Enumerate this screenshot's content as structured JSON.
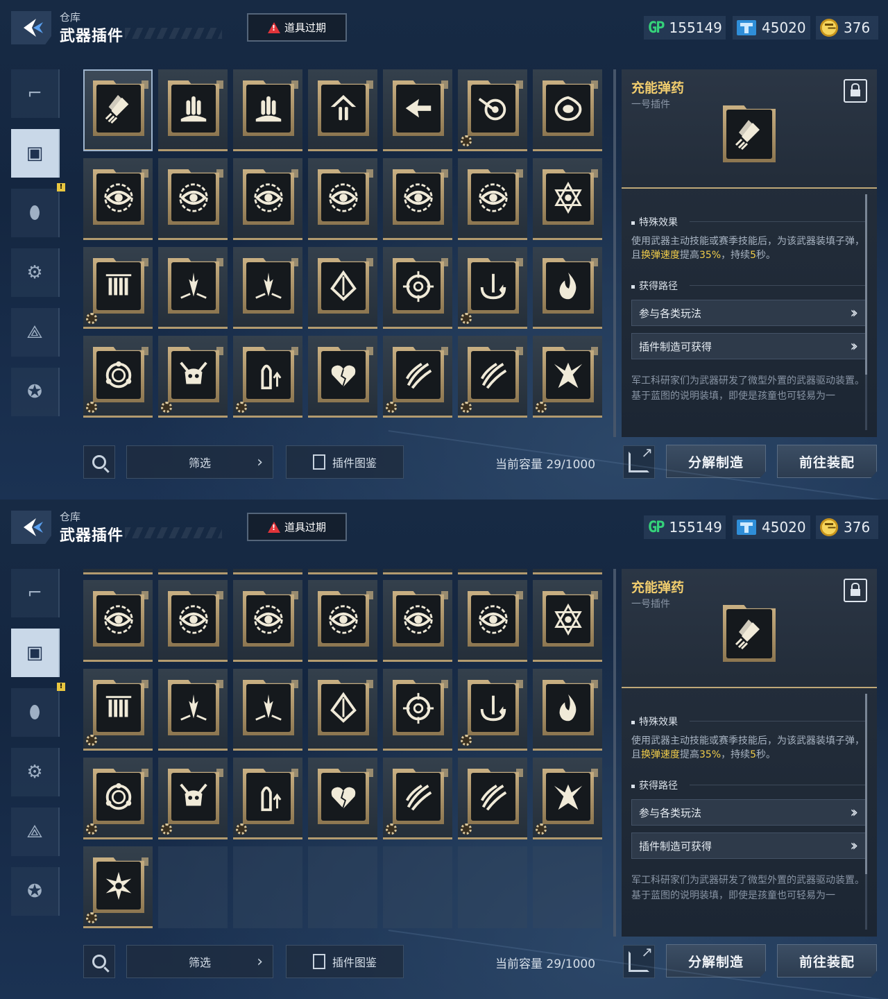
{
  "header": {
    "breadcrumb": "仓库",
    "title": "武器插件",
    "expire_label": "道具过期"
  },
  "currencies": [
    {
      "name": "GP",
      "icon": "gp-icon",
      "value": "155149"
    },
    {
      "name": "ticket",
      "icon": "ticket-icon",
      "value": "45020"
    },
    {
      "name": "coin",
      "icon": "coin-icon",
      "value": "376"
    }
  ],
  "sidebar": [
    {
      "icon": "gun-icon"
    },
    {
      "icon": "plugin-icon",
      "active": true
    },
    {
      "icon": "grenade-icon",
      "badge": "!"
    },
    {
      "icon": "weapon-mod-icon"
    },
    {
      "icon": "compass-icon"
    },
    {
      "icon": "star-badge-icon"
    }
  ],
  "plugins": [
    {
      "icon": "twin-bullets-icon",
      "sel": true
    },
    {
      "icon": "bullet-crown-icon"
    },
    {
      "icon": "bullet-crown-icon"
    },
    {
      "icon": "bullet-house-icon"
    },
    {
      "icon": "arrow-left-icon"
    },
    {
      "icon": "arrow-target-icon",
      "gear": true
    },
    {
      "icon": "splash-icon"
    },
    {
      "icon": "eye-icon"
    },
    {
      "icon": "eye-icon"
    },
    {
      "icon": "eye-icon"
    },
    {
      "icon": "eye-icon"
    },
    {
      "icon": "eye-icon"
    },
    {
      "icon": "eye-icon"
    },
    {
      "icon": "hexagram-icon"
    },
    {
      "icon": "ammo-reload-icon",
      "gear": true
    },
    {
      "icon": "down-burst-icon"
    },
    {
      "icon": "down-burst-icon"
    },
    {
      "icon": "diamond-arrow-icon"
    },
    {
      "icon": "crosshair-icon"
    },
    {
      "icon": "spiral-up-icon",
      "gear": true
    },
    {
      "icon": "flame-icon"
    },
    {
      "icon": "ring-shield-icon",
      "gear": true
    },
    {
      "icon": "demon-skull-icon",
      "gear": true
    },
    {
      "icon": "shell-up-icon",
      "gear": true
    },
    {
      "icon": "cracked-heart-icon"
    },
    {
      "icon": "claw-slash-icon",
      "gear": true
    },
    {
      "icon": "claw-slash-icon",
      "gear": true
    },
    {
      "icon": "dragon-head-icon",
      "gear": true
    },
    {
      "icon": "burst-combo-icon",
      "gear": true
    }
  ],
  "detail": {
    "name": "充能弹药",
    "slot": "一号插件",
    "effect_title": "特殊效果",
    "effect_pre": "使用武器主动技能或赛季技能后，为该武器装填子弹，且",
    "effect_hl1": "换弹速度",
    "effect_mid": "提高",
    "effect_hl2": "35%",
    "effect_post": "，持续",
    "effect_hl3": "5",
    "effect_end": "秒。",
    "route_title": "获得路径",
    "routes": [
      "参与各类玩法",
      "插件制造可获得"
    ],
    "lore": "军工科研家们为武器研发了微型外置的武器驱动装置。基于蓝图的说明装填，即使是孩童也可轻易为一"
  },
  "bottom": {
    "filter": "筛选",
    "codex": "插件图鉴",
    "capacity": "当前容量 29/1000",
    "decompose": "分解制造",
    "equip": "前往装配"
  },
  "colors": {
    "gold": "#f1cd6e",
    "accent_green": "#35d27a",
    "warn_red": "#e0343a"
  }
}
